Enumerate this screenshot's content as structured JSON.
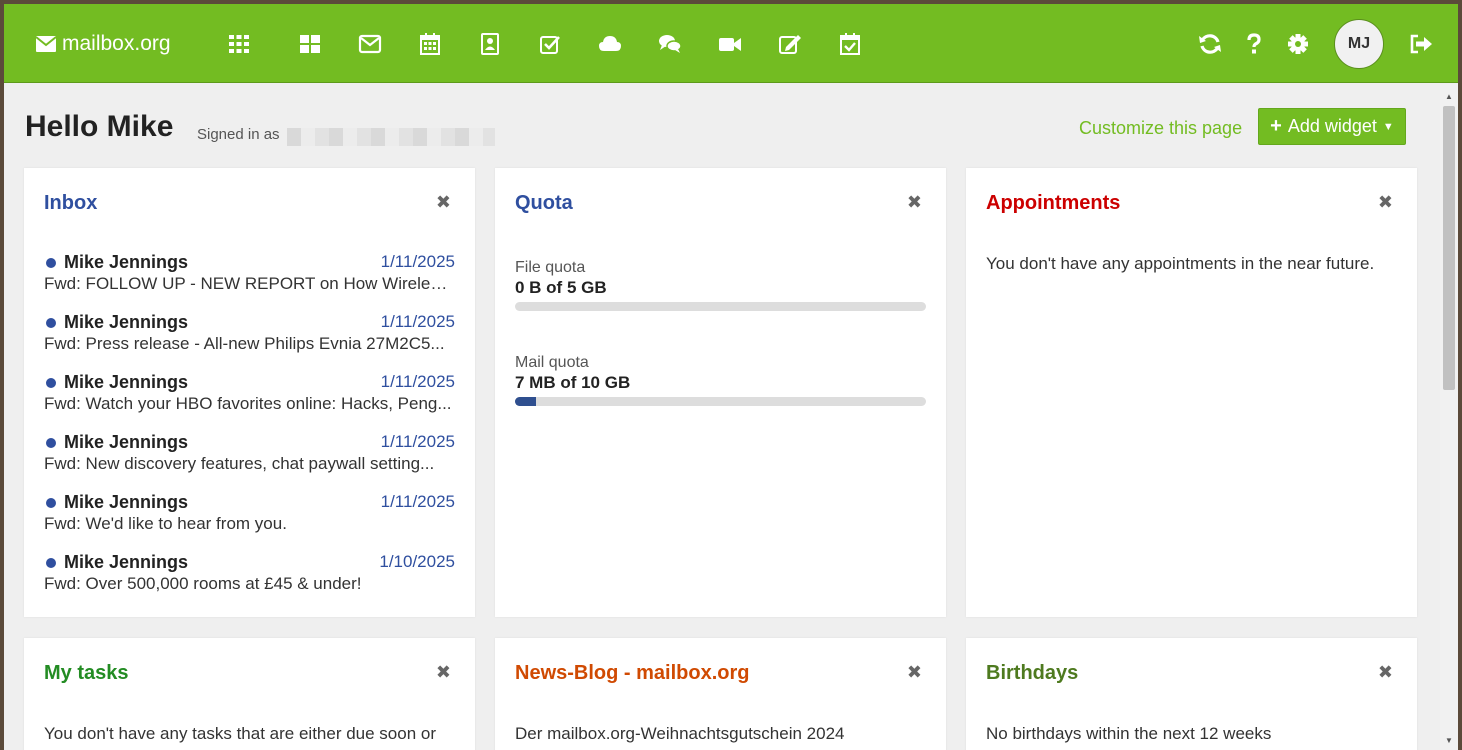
{
  "brand": {
    "name": "mailbox.org"
  },
  "colors": {
    "accent": "#73bc22",
    "link": "#2f4f9f",
    "appointments": "#cc0000",
    "tasks": "#238c23",
    "news": "#d04a02",
    "birthdays": "#4e7a1f"
  },
  "nav": {
    "icons": [
      "apps-grid-icon",
      "dashboard-icon",
      "mail-icon",
      "calendar-icon",
      "contacts-icon",
      "tasks-icon",
      "drive-icon",
      "chat-icon",
      "video-icon",
      "notes-icon",
      "scheduling-icon"
    ],
    "right": [
      "refresh-icon",
      "help-icon",
      "settings-icon",
      "logout-icon"
    ],
    "avatar_initials": "MJ"
  },
  "header": {
    "greeting": "Hello Mike",
    "signed_in_as": "Signed in as",
    "customize": "Customize this page",
    "add_widget": "Add widget"
  },
  "widgets": {
    "inbox": {
      "title": "Inbox",
      "messages": [
        {
          "from": "Mike Jennings",
          "date": "1/11/2025",
          "subject": "Fwd: FOLLOW UP - NEW REPORT on How Wireless ..."
        },
        {
          "from": "Mike Jennings",
          "date": "1/11/2025",
          "subject": "Fwd: Press release - All-new Philips Evnia 27M2C5..."
        },
        {
          "from": "Mike Jennings",
          "date": "1/11/2025",
          "subject": "Fwd: Watch your HBO favorites online: Hacks, Peng..."
        },
        {
          "from": "Mike Jennings",
          "date": "1/11/2025",
          "subject": "Fwd: New discovery features, chat paywall setting..."
        },
        {
          "from": "Mike Jennings",
          "date": "1/11/2025",
          "subject": "Fwd: We'd like to hear from you."
        },
        {
          "from": "Mike Jennings",
          "date": "1/10/2025",
          "subject": "Fwd: Over 500,000 rooms at £45 & under!"
        }
      ]
    },
    "quota": {
      "title": "Quota",
      "file_label": "File quota",
      "file_value": "0 B of 5 GB",
      "file_fraction": 0.0,
      "mail_label": "Mail quota",
      "mail_value": "7 MB of 10 GB",
      "mail_fraction": 0.05
    },
    "appointments": {
      "title": "Appointments",
      "text": "You don't have any appointments in the near future."
    },
    "tasks": {
      "title": "My tasks",
      "text": "You don't have any tasks that are either due soon or"
    },
    "news": {
      "title": "News-Blog - mailbox.org",
      "text": "Der mailbox.org-Weihnachtsgutschein 2024"
    },
    "birthdays": {
      "title": "Birthdays",
      "text": "No birthdays within the next 12 weeks"
    }
  }
}
